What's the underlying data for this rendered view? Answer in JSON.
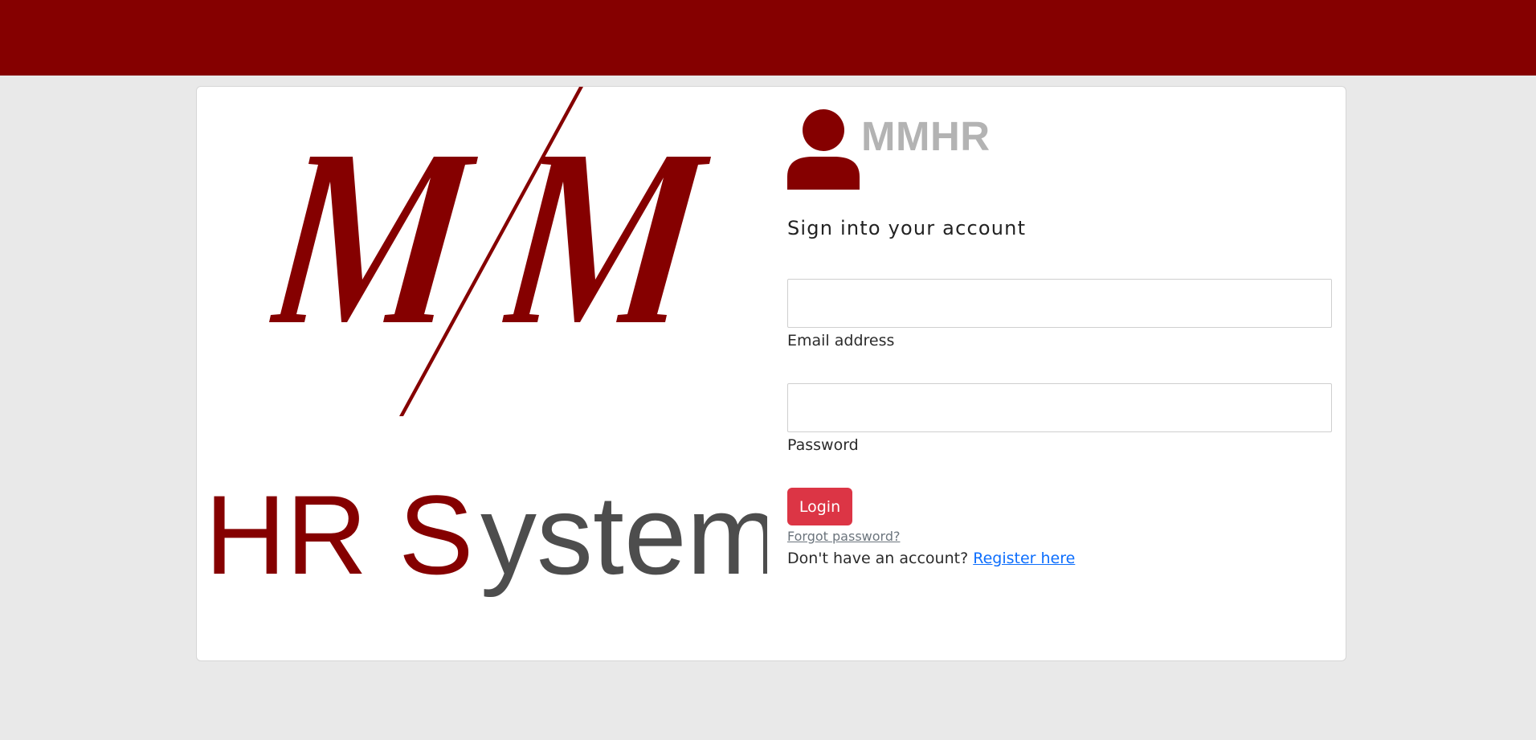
{
  "brand": {
    "name": "MMHR",
    "logo_text": "HR System",
    "logo_letters": "M/M"
  },
  "form": {
    "heading": "Sign into your account",
    "email_label": "Email address",
    "email_value": "",
    "password_label": "Password",
    "password_value": "",
    "login_label": "Login",
    "forgot_label": "Forgot password?",
    "register_prompt": "Don't have an account?",
    "register_label": "Register here"
  },
  "colors": {
    "topbar": "#850000",
    "brand_dark_red": "#850000",
    "logo_gray": "#4d4d4d",
    "login_button": "#dc3545",
    "link_blue": "#0d6efd"
  },
  "icons": {
    "brand": "user-icon"
  }
}
